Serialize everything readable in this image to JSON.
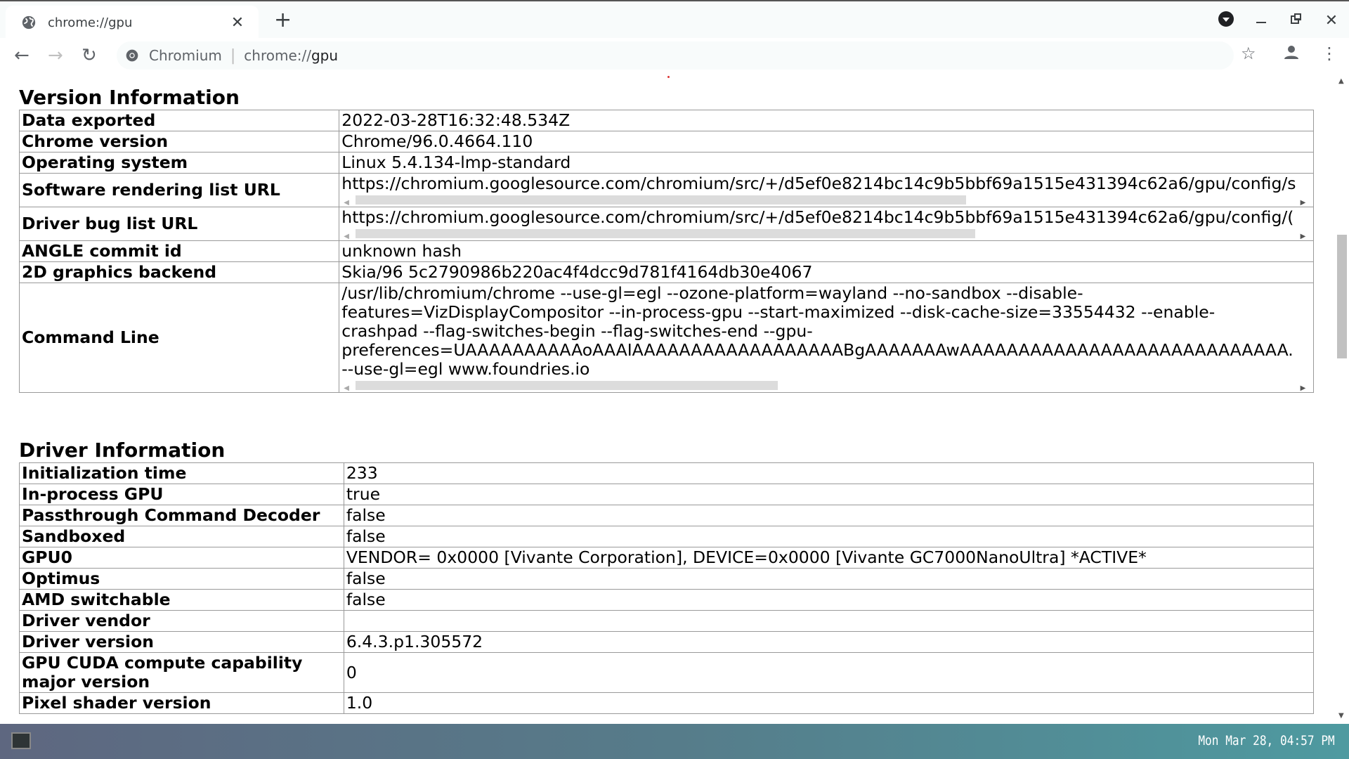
{
  "browser": {
    "tab_title": "chrome://gpu",
    "omnibox_site": "Chromium",
    "omnibox_url_prefix": "chrome://",
    "omnibox_url_path": "gpu"
  },
  "sections": {
    "version": {
      "heading": "Version Information",
      "rows": [
        {
          "key": "Data exported",
          "value": "2022-03-28T16:32:48.534Z"
        },
        {
          "key": "Chrome version",
          "value": "Chrome/96.0.4664.110"
        },
        {
          "key": "Operating system",
          "value": "Linux 5.4.134-lmp-standard"
        },
        {
          "key": "Software rendering list URL",
          "value": "https://chromium.googlesource.com/chromium/src/+/d5ef0e8214bc14c9b5bbf69a1515e431394c62a6/gpu/config/s"
        },
        {
          "key": "Driver bug list URL",
          "value": "https://chromium.googlesource.com/chromium/src/+/d5ef0e8214bc14c9b5bbf69a1515e431394c62a6/gpu/config/("
        },
        {
          "key": "ANGLE commit id",
          "value": "unknown hash"
        },
        {
          "key": "2D graphics backend",
          "value": "Skia/96 5c2790986b220ac4f4dcc9d781f4164db30e4067"
        },
        {
          "key": "Command Line",
          "value": "/usr/lib/chromium/chrome --use-gl=egl --ozone-platform=wayland --no-sandbox --disable-features=VizDisplayCompositor --in-process-gpu --start-maximized --disk-cache-size=33554432 --enable-crashpad --flag-switches-begin --flag-switches-end --gpu-preferences=UAAAAAAAAAAoAAAIAAAAAAAAAAAAAAAAAABgAAAAAAAwAAAAAAAAAAAAAAAAAAAAAAAAAAAA... --use-gl=egl www.foundries.io"
        }
      ]
    },
    "driver": {
      "heading": "Driver Information",
      "rows": [
        {
          "key": "Initialization time",
          "value": "233"
        },
        {
          "key": "In-process GPU",
          "value": "true"
        },
        {
          "key": "Passthrough Command Decoder",
          "value": "false"
        },
        {
          "key": "Sandboxed",
          "value": "false"
        },
        {
          "key": "GPU0",
          "value": "VENDOR= 0x0000 [Vivante Corporation], DEVICE=0x0000 [Vivante GC7000NanoUltra] *ACTIVE*"
        },
        {
          "key": "Optimus",
          "value": "false"
        },
        {
          "key": "AMD switchable",
          "value": "false"
        },
        {
          "key": "Driver vendor",
          "value": ""
        },
        {
          "key": "Driver version",
          "value": "6.4.3.p1.305572"
        },
        {
          "key": "GPU CUDA compute capability major version",
          "value": "0"
        },
        {
          "key": "Pixel shader version",
          "value": "1.0"
        }
      ]
    }
  },
  "cmdline_lines": [
    "/usr/lib/chromium/chrome --use-gl=egl --ozone-platform=wayland --no-sandbox --disable-",
    "features=VizDisplayCompositor --in-process-gpu --start-maximized --disk-cache-size=33554432 --enable-",
    "crashpad --flag-switches-begin --flag-switches-end --gpu-",
    "preferences=UAAAAAAAAAAoAAAIAAAAAAAAAAAAAAAAAABgAAAAAAAwAAAAAAAAAAAAAAAAAAAAAAAAAAAA.",
    "--use-gl=egl www.foundries.io"
  ],
  "scrollbars": {
    "software_rendering_url_visible_fraction": 0.65,
    "driver_bug_url_visible_fraction": 0.66,
    "command_line_visible_fraction": 0.45
  },
  "taskbar": {
    "clock": "Mon Mar 28, 04:57 PM"
  }
}
